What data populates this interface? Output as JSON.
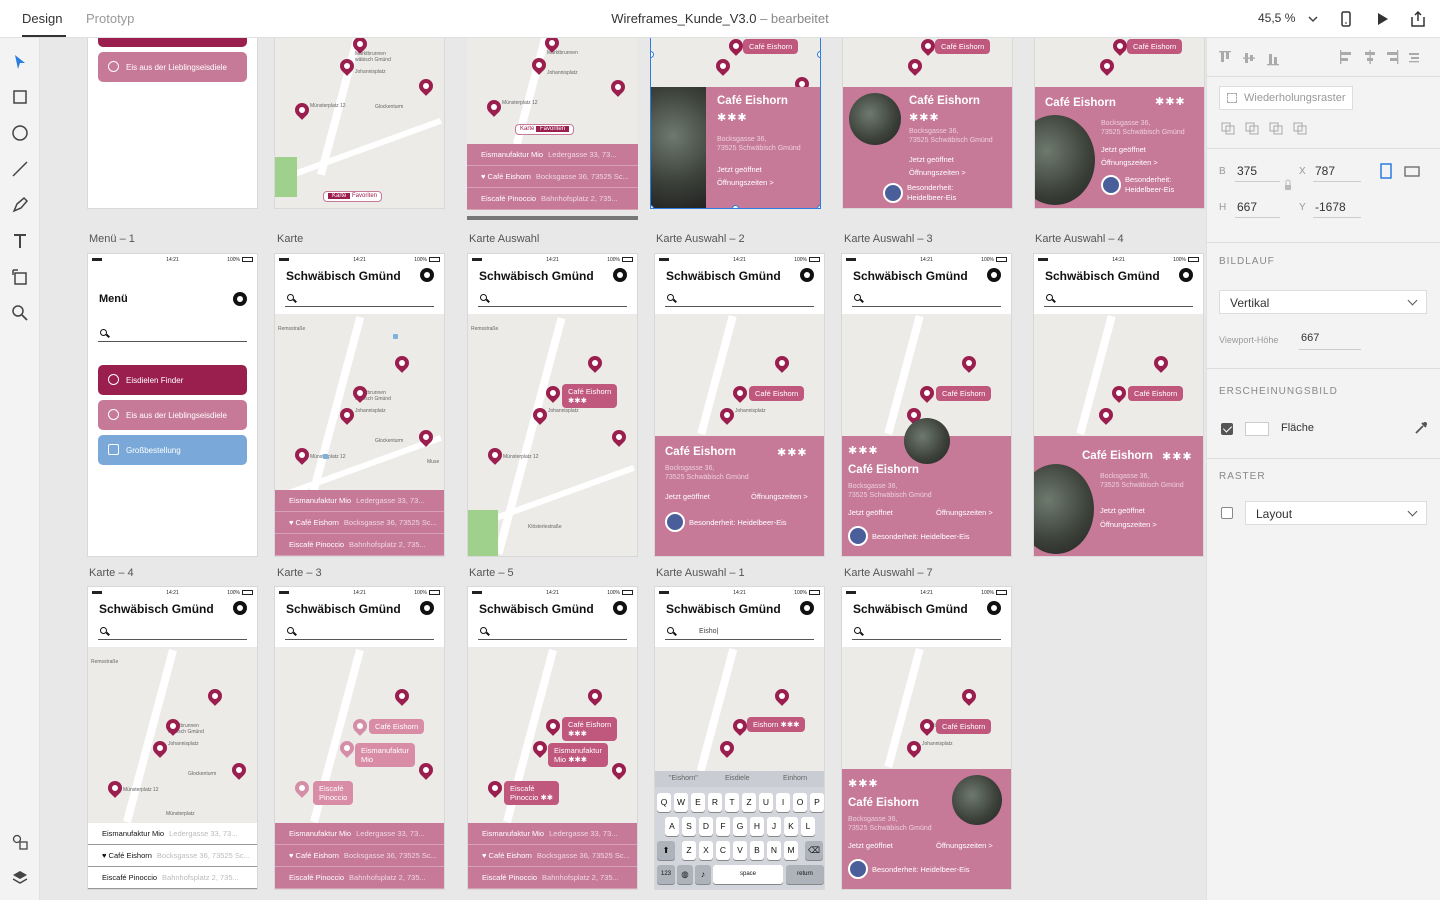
{
  "topbar": {
    "tab_design": "Design",
    "tab_prototype": "Prototyp",
    "doc_name": "Wireframes_Kunde_V3.0",
    "doc_state": "– bearbeitet",
    "zoom": "45,5 %"
  },
  "status": {
    "time": "14:21",
    "battery": "100%"
  },
  "app": {
    "city": "Schwäbisch Gmünd",
    "menu_title": "Menü"
  },
  "map_text": {
    "marktbrunnen": "Marktbrunnen",
    "gmuend": "wäbisch Gmünd",
    "johannisplatz": "Johannisplatz",
    "glockenturm": "Glockenturm",
    "muensterplatz12": "Münsterplatz 12",
    "muensterplatz": "Münsterplatz",
    "remsstrasse": "Remsstraße",
    "klosterstrasse": "Klösterlestraße",
    "museum": "Muse",
    "ott": "Ott-P"
  },
  "menu": {
    "finder": "Eisdielen Finder",
    "favorites": "Eis aus der Lieblingseisdiele",
    "bulk": "Großbestellung"
  },
  "places": [
    {
      "name": "Eismanufaktur Mio",
      "address": "Ledergasse 33, 73..."
    },
    {
      "name": "Café Eishorn",
      "address": "Bocksgasse 36, 73525 Sc..."
    },
    {
      "name": "Eiscafé Pinoccio",
      "address": "Bahnhofsplatz 2, 735..."
    }
  ],
  "cafe": {
    "name": "Café Eishorn",
    "stars": "✱✱✱",
    "street": "Bocksgasse 36,",
    "city_line": "73525 Schwäbisch Gmünd",
    "open_now": "Jetzt geöffnet",
    "hours": "Öffnungszeiten >",
    "special": "Besonderheit: Heidelbeer-Eis",
    "special_a": "Besonderheit:",
    "special_b": "Heidelbeer-Eis"
  },
  "bubbles": {
    "eishorn": "Café Eishorn",
    "mio": "Eismanufaktur Mio",
    "mio_a": "Eismanufaktur",
    "mio_b": "Mio",
    "pinoccio_a": "Eiscafé",
    "pinoccio_b": "Pinoccio",
    "eishorn_short": "Eishorn",
    "stars2": "✱✱"
  },
  "toggle": {
    "map": "Karte",
    "favorites": "Favoriten"
  },
  "keyboard": {
    "search_text": "Eisho|",
    "suggestions": [
      "\"Eishorn\"",
      "Eisdiele",
      "Einhorn"
    ],
    "row1": [
      "Q",
      "W",
      "E",
      "R",
      "T",
      "Z",
      "U",
      "I",
      "O",
      "P"
    ],
    "row2": [
      "A",
      "S",
      "D",
      "F",
      "G",
      "H",
      "J",
      "K",
      "L"
    ],
    "row3": [
      "Z",
      "X",
      "C",
      "V",
      "B",
      "N",
      "M"
    ],
    "num": "123",
    "space": "space",
    "return": "return"
  },
  "labels": {
    "menu1": "Menü – 1",
    "karte": "Karte",
    "karte_auswahl": "Karte Auswahl",
    "ka2": "Karte Auswahl – 2",
    "ka3": "Karte Auswahl – 3",
    "ka4": "Karte Auswahl – 4",
    "karte4": "Karte – 4",
    "karte3": "Karte – 3",
    "karte5": "Karte – 5",
    "ka1": "Karte Auswahl – 1",
    "ka7": "Karte Auswahl – 7"
  },
  "inspector": {
    "repeat_grid": "Wiederholungsraster",
    "b_label": "B",
    "b_val": "375",
    "x_label": "X",
    "x_val": "787",
    "h_label": "H",
    "h_val": "667",
    "y_label": "Y",
    "y_val": "-1678",
    "scroll_title": "BILDLAUF",
    "scroll_value": "Vertikal",
    "viewport_label": "Viewport-Höhe",
    "viewport_value": "667",
    "appearance_title": "ERSCHEINUNGSBILD",
    "fill_label": "Fläche",
    "grid_title": "RASTER",
    "grid_value": "Layout"
  },
  "colors": {
    "brand_dark": "#9a1e4e",
    "brand": "#c77a97",
    "bulk_blue": "#7aa9d9",
    "selection": "#2d7de0"
  }
}
